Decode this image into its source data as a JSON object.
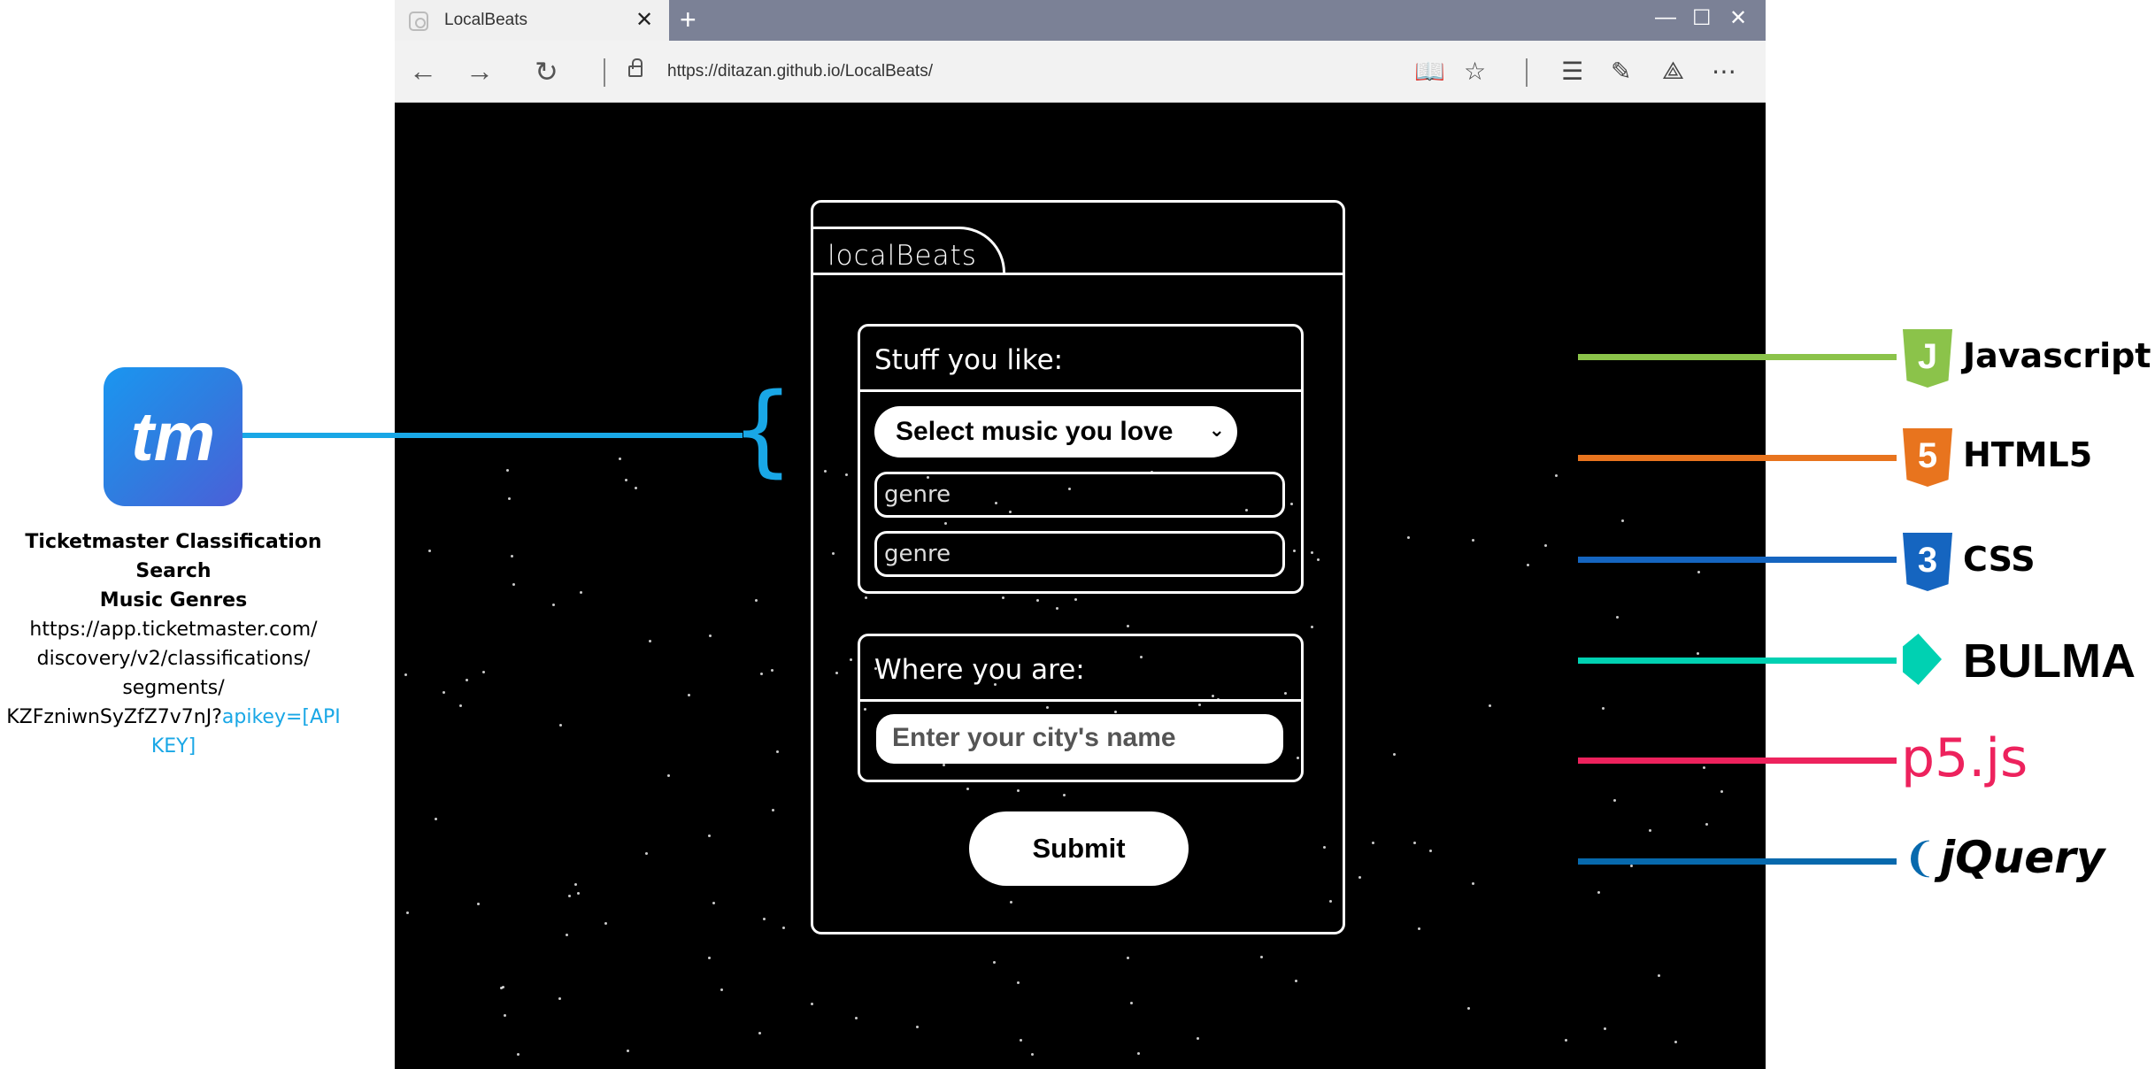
{
  "browser": {
    "tab_title": "LocalBeats",
    "tab_close": "✕",
    "new_tab": "+",
    "minimize": "—",
    "maximize": "☐",
    "close": "✕",
    "url": "https://ditazan.github.io/LocalBeats/",
    "icons": [
      "back-icon",
      "forward-icon",
      "refresh-icon",
      "lock-icon",
      "reading-view-icon",
      "favorite-star-icon",
      "hub-icon",
      "web-note-icon",
      "share-icon",
      "more-icon"
    ]
  },
  "app": {
    "title": "localBeats",
    "likes_title": "Stuff you like:",
    "music_select": "Select music you love",
    "genre_1": "genre",
    "genre_2": "genre",
    "where_title": "Where you are:",
    "city_placeholder": "Enter your city's name",
    "submit": "Submit"
  },
  "annotation": {
    "logo_text": "tm",
    "caption_bold_1": "Ticketmaster Classification Search",
    "caption_bold_2": "Music Genres",
    "caption_line_1": "https://app.ticketmaster.com/",
    "caption_line_2": "discovery/v2/classifications/",
    "caption_line_3": "segments/",
    "caption_line_4": "KZFzniwnSyZfZ7v7nJ?",
    "caption_key_1": "apikey=[API",
    "caption_key_2": "KEY]",
    "accent_color": "#19a7e6"
  },
  "tech": [
    {
      "label": "Javascript",
      "color": "#8bc34a"
    },
    {
      "label": "HTML5",
      "color": "#e8741e"
    },
    {
      "label": "CSS",
      "color": "#1565c0"
    },
    {
      "label": "BULMA",
      "color": "#00d1b2"
    },
    {
      "label": "p5.js",
      "color": "#ed225d"
    },
    {
      "label": "jQuery",
      "color": "#0769ad"
    }
  ]
}
